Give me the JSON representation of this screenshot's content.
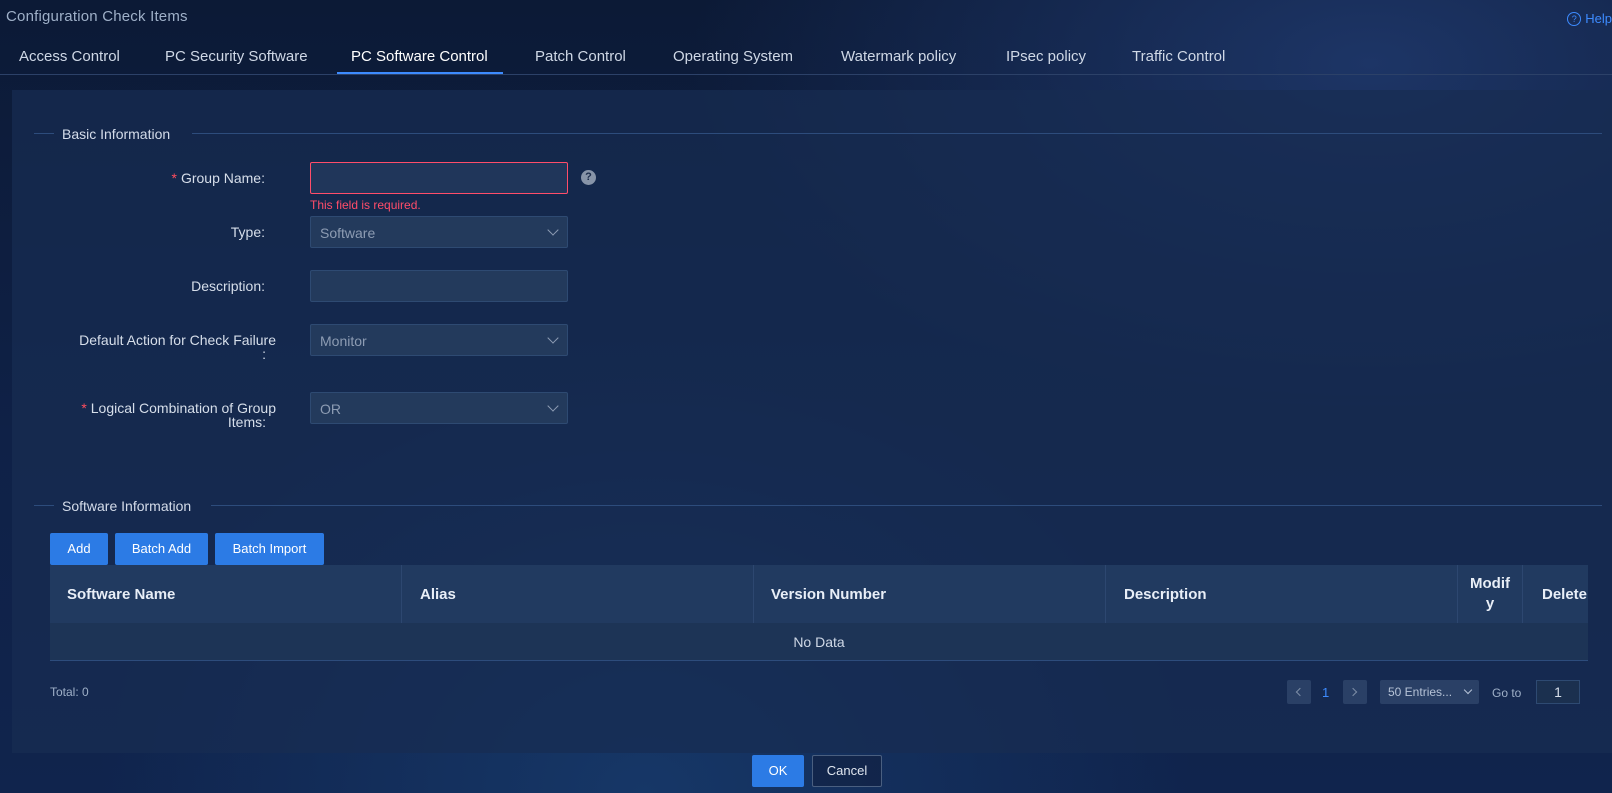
{
  "page": {
    "title": "Configuration Check Items",
    "help": "Help"
  },
  "tabs": [
    {
      "label": "Access Control"
    },
    {
      "label": "PC Security Software"
    },
    {
      "label": "PC Software Control",
      "active": true
    },
    {
      "label": "Patch Control"
    },
    {
      "label": "Operating System"
    },
    {
      "label": "Watermark policy"
    },
    {
      "label": "IPsec policy"
    },
    {
      "label": "Traffic Control"
    }
  ],
  "basic": {
    "section_title": "Basic Information",
    "group_name": {
      "label": "Group Name:",
      "value": "",
      "error": "This field is required."
    },
    "type": {
      "label": "Type:",
      "value": "Software"
    },
    "description": {
      "label": "Description:",
      "value": ""
    },
    "default_action": {
      "label_line1": "Default Action for Check Failure",
      "label_line2": ":",
      "value": "Monitor"
    },
    "logical": {
      "label_line1": "Logical Combination of Group",
      "label_line2": "Items:",
      "value": "OR"
    }
  },
  "software": {
    "section_title": "Software Information",
    "buttons": {
      "add": "Add",
      "batch_add": "Batch Add",
      "batch_import": "Batch Import"
    },
    "columns": [
      "Software Name",
      "Alias",
      "Version Number",
      "Description",
      "Modif",
      "y",
      "Delete"
    ],
    "empty": "No Data",
    "total": "Total: 0",
    "page": "1",
    "page_size": "50 Entries...",
    "goto_label": "Go to",
    "goto_value": "1"
  },
  "footer": {
    "ok": "OK",
    "cancel": "Cancel"
  },
  "colors": {
    "accent": "#2c7be5",
    "error": "#ff4d6a",
    "active_tab": "#3d8bff"
  }
}
